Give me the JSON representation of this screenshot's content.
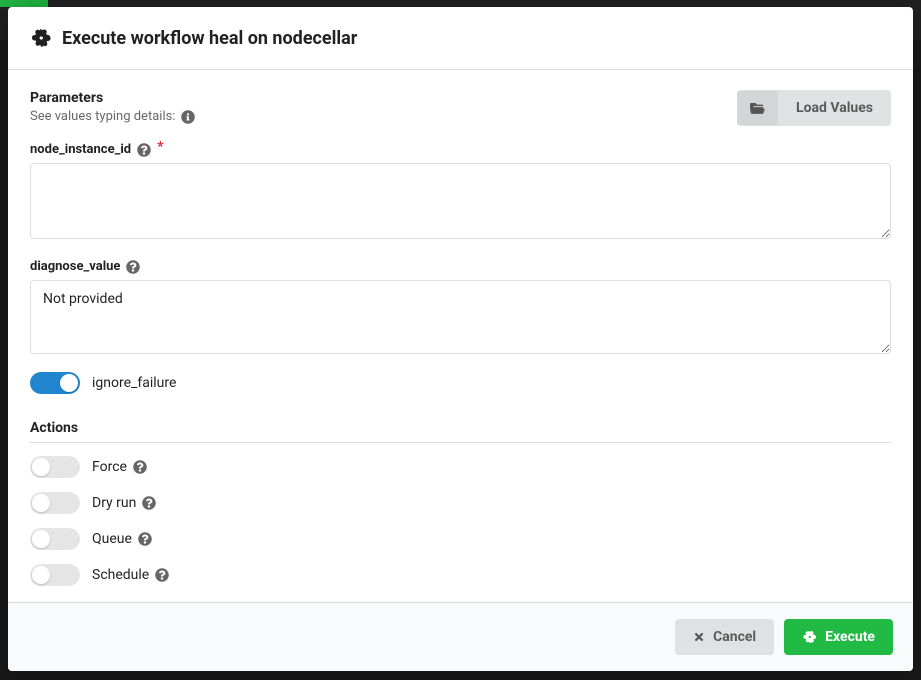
{
  "header": {
    "title": "Execute workflow heal on nodecellar"
  },
  "parameters": {
    "section_label": "Parameters",
    "typing_hint": "See values typing details:",
    "load_values_label": "Load Values",
    "fields": {
      "node_instance_id": {
        "label": "node_instance_id",
        "value": "",
        "required": true
      },
      "diagnose_value": {
        "label": "diagnose_value",
        "value": "Not provided",
        "required": false
      }
    },
    "ignore_failure": {
      "label": "ignore_failure",
      "value": true
    }
  },
  "actions": {
    "section_label": "Actions",
    "items": {
      "force": {
        "label": "Force",
        "value": false,
        "help": true
      },
      "dry_run": {
        "label": "Dry run",
        "value": false,
        "help": true
      },
      "queue": {
        "label": "Queue",
        "value": false,
        "help": true
      },
      "schedule": {
        "label": "Schedule",
        "value": false,
        "help": true
      }
    }
  },
  "footer": {
    "cancel_label": "Cancel",
    "execute_label": "Execute"
  }
}
